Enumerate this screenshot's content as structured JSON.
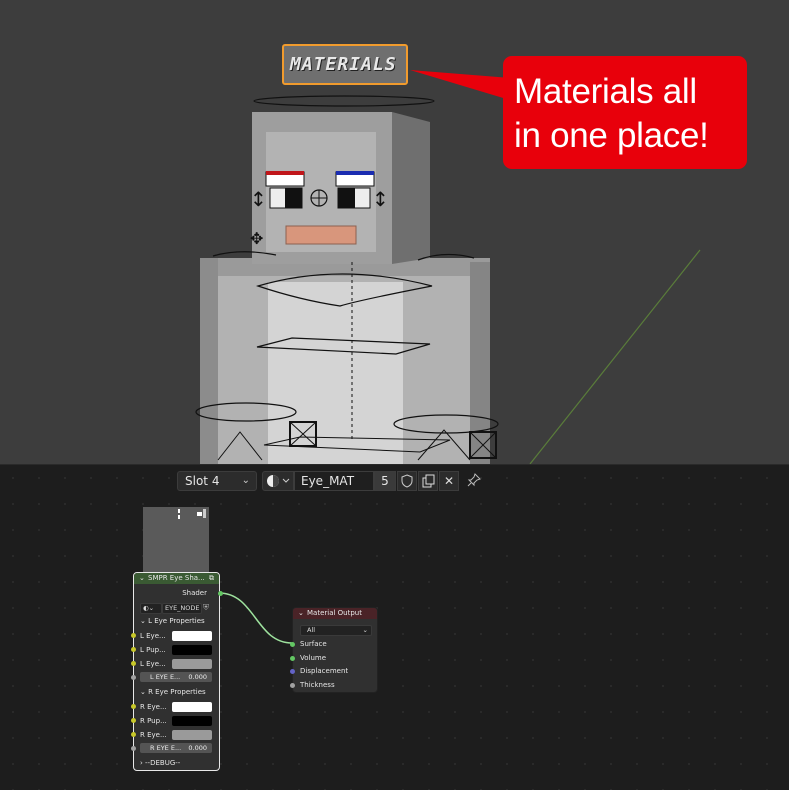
{
  "viewport": {
    "label_plate": "MATERIALS",
    "callout": {
      "line1": "Materials all",
      "line2": "in one place!"
    }
  },
  "toolbar": {
    "slot": "Slot 4",
    "material_name": "Eye_MAT",
    "users": "5"
  },
  "group_node": {
    "title": "SMPR Eye Sha...",
    "output_label": "Shader",
    "node_tree": "EYE_NODE",
    "l_panel": "L Eye Properties",
    "l_rows": [
      "L Eye...",
      "L Pup...",
      "L Eye..."
    ],
    "l_value_label": "L EYE E...",
    "l_value": "0.000",
    "r_panel": "R Eye Properties",
    "r_rows": [
      "R Eye...",
      "R Pup...",
      "R Eye..."
    ],
    "r_value_label": "R EYE E...",
    "r_value": "0.000",
    "debug_panel": "--DEBUG--",
    "colors": {
      "white": "#ffffff",
      "black": "#000000",
      "gray": "#9a9a9a"
    }
  },
  "output_node": {
    "title": "Material Output",
    "target": "All",
    "inputs": [
      "Surface",
      "Volume",
      "Displacement",
      "Thickness"
    ],
    "colors": {
      "header": "#4a2327",
      "shader_socket": "#63c763",
      "vector_socket": "#6363c7",
      "float_socket": "#a1a1a1"
    }
  },
  "colors": {
    "callout": "#e8000b",
    "label_border": "#f19b2d",
    "link": "#9ee29e"
  }
}
